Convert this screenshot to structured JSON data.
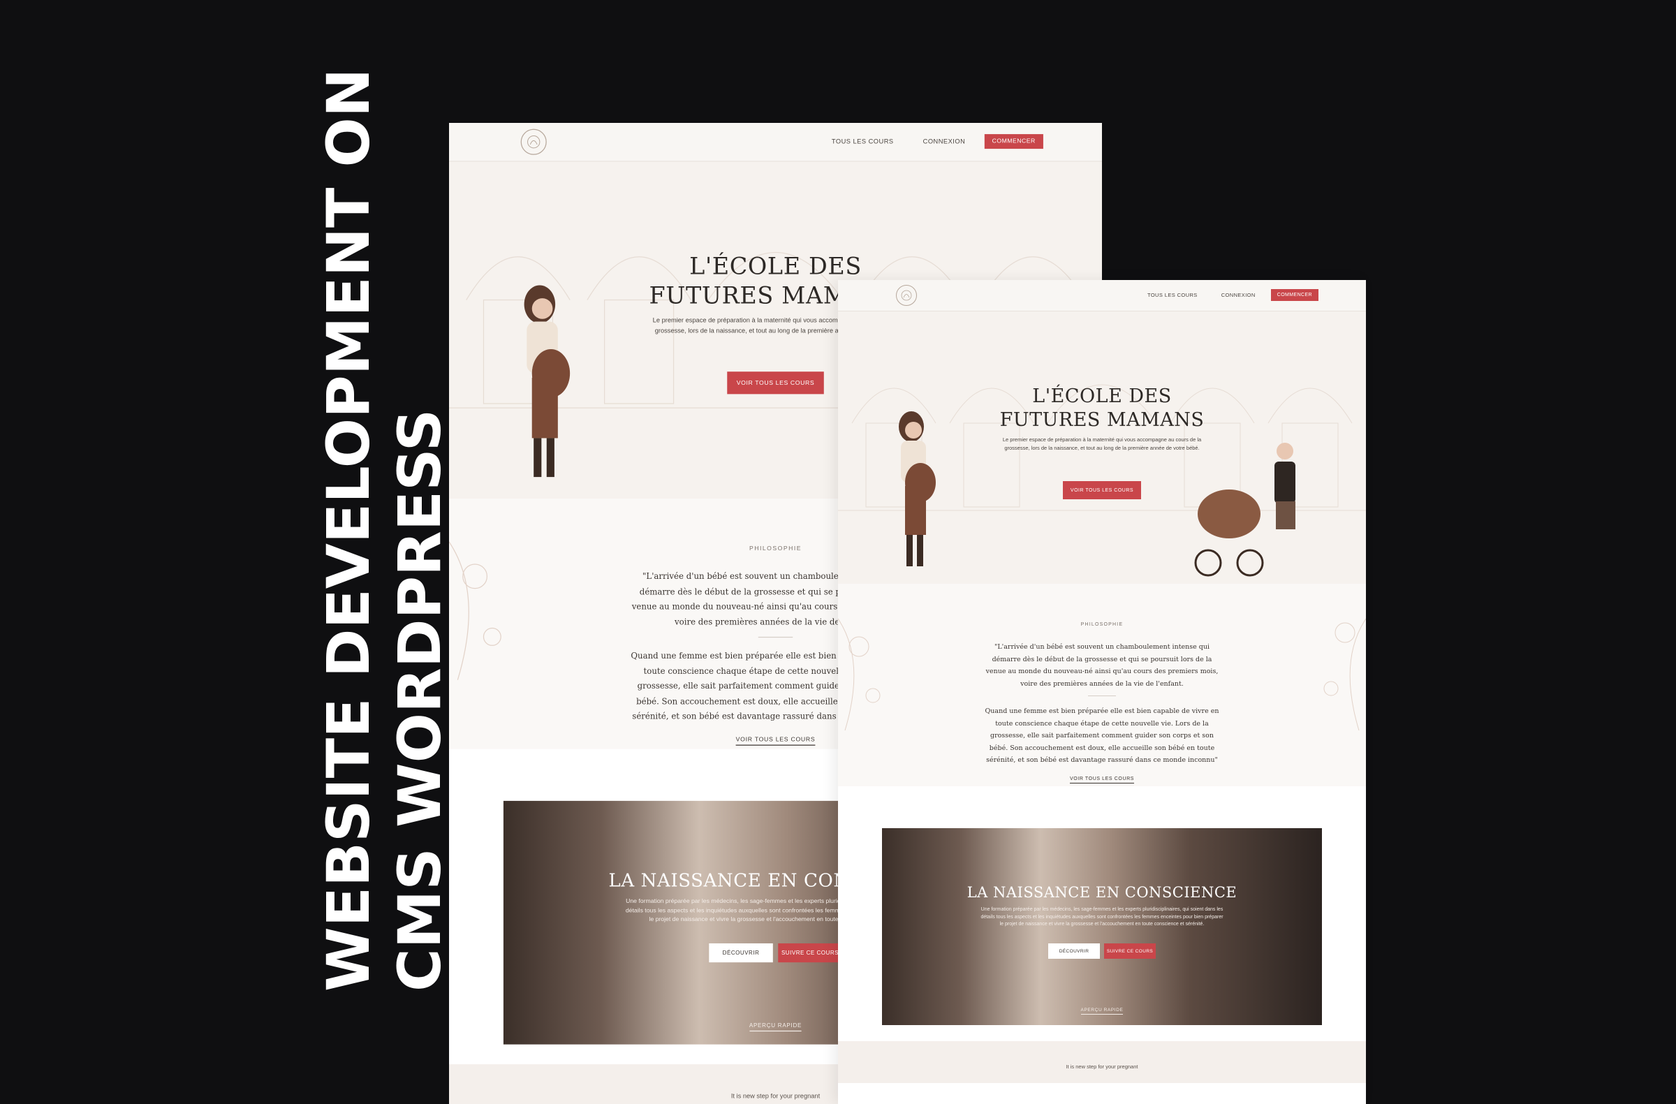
{
  "headline": {
    "line1": "WEBSITE DEVELOPMENT ON",
    "line2": "CMS WORDPRESS"
  },
  "site": {
    "nav": {
      "all_courses": "TOUS LES COURS",
      "login": "CONNEXION",
      "start": "COMMENCER"
    },
    "hero": {
      "title_line1": "L'ÉCOLE DES",
      "title_line2": "FUTURES MAMANS",
      "subtitle": "Le premier espace de préparation à la maternité qui vous accompagne au cours de la grossesse, lors de la naissance, et tout au long de la première année de votre bébé.",
      "cta": "VOIR TOUS LES COURS"
    },
    "philosophy": {
      "label": "PHILOSOPHIE",
      "quote1": "\"L'arrivée d'un bébé est souvent un chamboulement intense qui démarre dès le début de la grossesse et qui se poursuit lors de la venue au monde du nouveau-né ainsi qu'au cours des premiers mois, voire des premières années de la vie de l'enfant.",
      "quote2": "Quand une femme est bien préparée elle est bien capable de vivre en toute conscience chaque étape de cette nouvelle vie. Lors de la grossesse, elle sait parfaitement comment guider son corps et son bébé. Son accouchement est doux, elle accueille son bébé en toute sérénité, et son bébé est davantage rassuré dans ce monde inconnu\"",
      "link": "VOIR TOUS LES COURS"
    },
    "course": {
      "title": "LA NAISSANCE EN CONSCIENCE",
      "text": "Une formation préparée par les médecins, les sage-femmes et les experts pluridisciplinaires, qui soient dans les détails tous les aspects et les inquiétudes auxquelles sont confrontées les femmes enceintes pour bien préparer le projet de naissance et vivre la grossesse et l'accouchement en toute conscience et sérénité.",
      "discover": "DÉCOUVRIR",
      "follow": "SUIVRE CE COURS",
      "preview": "APERÇU RAPIDE"
    },
    "footer_strip": "It is new step for your pregnant"
  },
  "colors": {
    "background": "#0f0f11",
    "accent_red": "#c9464a",
    "cream": "#f6f2ee"
  }
}
